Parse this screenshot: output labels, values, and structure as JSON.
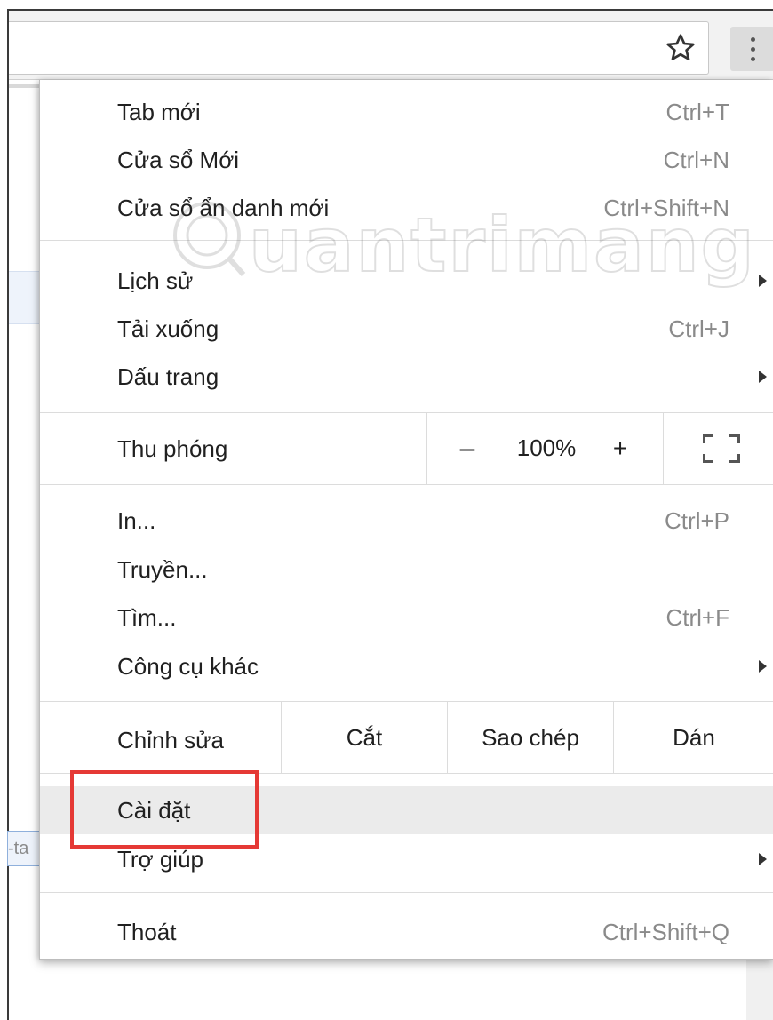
{
  "toolbar": {
    "bookmark_icon": "star-icon",
    "menu_icon": "three-dots-vertical-icon"
  },
  "page": {
    "partial_text": "-ta"
  },
  "menu": {
    "group1": [
      {
        "label": "Tab mới",
        "shortcut": "Ctrl+T"
      },
      {
        "label": "Cửa sổ Mới",
        "shortcut": "Ctrl+N"
      },
      {
        "label": "Cửa sổ ẩn danh mới",
        "shortcut": "Ctrl+Shift+N"
      }
    ],
    "group2": [
      {
        "label": "Lịch sử",
        "has_submenu": true
      },
      {
        "label": "Tải xuống",
        "shortcut": "Ctrl+J"
      },
      {
        "label": "Dấu trang",
        "has_submenu": true
      }
    ],
    "zoom": {
      "label": "Thu phóng",
      "minus": "–",
      "value": "100%",
      "plus": "+",
      "fullscreen_icon": "fullscreen-icon"
    },
    "group3": [
      {
        "label": "In...",
        "shortcut": "Ctrl+P"
      },
      {
        "label": "Truyền..."
      },
      {
        "label": "Tìm...",
        "shortcut": "Ctrl+F"
      },
      {
        "label": "Công cụ khác",
        "has_submenu": true
      }
    ],
    "edit": {
      "label": "Chỉnh sửa",
      "cut": "Cắt",
      "copy": "Sao chép",
      "paste": "Dán"
    },
    "group4": [
      {
        "label": "Cài đặt",
        "highlighted": true
      },
      {
        "label": "Trợ giúp",
        "has_submenu": true
      }
    ],
    "group5": [
      {
        "label": "Thoát",
        "shortcut": "Ctrl+Shift+Q"
      }
    ]
  },
  "annotation": {
    "color": "#e53935"
  },
  "watermark": {
    "text": "uantrimang"
  }
}
